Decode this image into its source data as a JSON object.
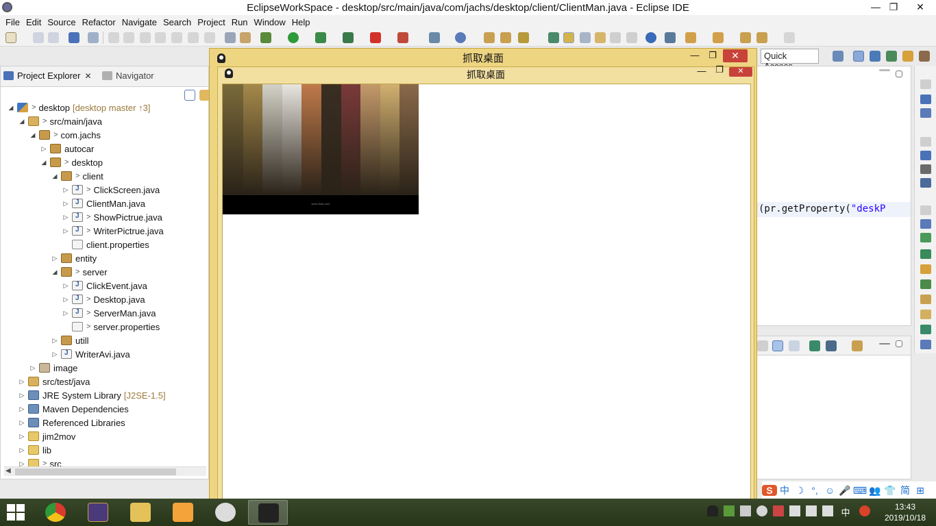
{
  "window": {
    "title": "EclipseWorkSpace - desktop/src/main/java/com/jachs/desktop/client/ClientMan.java - Eclipse IDE",
    "minimize": "—",
    "maximize": "❐",
    "close": "✕"
  },
  "menu": [
    "File",
    "Edit",
    "Source",
    "Refactor",
    "Navigate",
    "Search",
    "Project",
    "Run",
    "Window",
    "Help"
  ],
  "quick_access": "Quick Access",
  "explorer": {
    "tab_active": "Project Explorer",
    "tab_inactive": "Navigator",
    "tree": [
      {
        "label": "desktop",
        "deco": "[desktop master ↑3]",
        "dirty": true,
        "icon": "project",
        "twisty": "▲",
        "indent": 0
      },
      {
        "label": "src/main/java",
        "dirty": true,
        "icon": "srcfolder",
        "twisty": "▲",
        "indent": 1
      },
      {
        "label": "com.jachs",
        "dirty": true,
        "icon": "package",
        "twisty": "▲",
        "indent": 2
      },
      {
        "label": "autocar",
        "icon": "package",
        "twisty": "▷",
        "indent": 3
      },
      {
        "label": "desktop",
        "dirty": true,
        "icon": "package",
        "twisty": "▲",
        "indent": 3
      },
      {
        "label": "client",
        "dirty": true,
        "icon": "package",
        "twisty": "▲",
        "indent": 4
      },
      {
        "label": "ClickScreen.java",
        "dirty": true,
        "icon": "java",
        "twisty": "▷",
        "indent": 5
      },
      {
        "label": "ClientMan.java",
        "icon": "java",
        "twisty": "▷",
        "indent": 5
      },
      {
        "label": "ShowPictrue.java",
        "dirty": true,
        "icon": "java",
        "twisty": "▷",
        "indent": 5
      },
      {
        "label": "WriterPictrue.java",
        "dirty": true,
        "icon": "java",
        "twisty": "▷",
        "indent": 5
      },
      {
        "label": "client.properties",
        "icon": "props",
        "twisty": "",
        "indent": 5
      },
      {
        "label": "entity",
        "icon": "package",
        "twisty": "▷",
        "indent": 4
      },
      {
        "label": "server",
        "dirty": true,
        "icon": "package",
        "twisty": "▲",
        "indent": 4
      },
      {
        "label": "ClickEvent.java",
        "icon": "java",
        "twisty": "▷",
        "indent": 5
      },
      {
        "label": "Desktop.java",
        "dirty": true,
        "icon": "java",
        "twisty": "▷",
        "indent": 5
      },
      {
        "label": "ServerMan.java",
        "dirty": true,
        "icon": "java",
        "twisty": "▷",
        "indent": 5
      },
      {
        "label": "server.properties",
        "dirty": true,
        "icon": "props",
        "twisty": "",
        "indent": 5
      },
      {
        "label": "utill",
        "icon": "package",
        "twisty": "▷",
        "indent": 4
      },
      {
        "label": "WriterAvi.java",
        "icon": "java",
        "twisty": "▷",
        "indent": 4
      },
      {
        "label": "image",
        "icon": "img",
        "twisty": "▷",
        "indent": 2
      },
      {
        "label": "src/test/java",
        "icon": "srcfolder",
        "twisty": "▷",
        "indent": 1
      },
      {
        "label": "JRE System Library",
        "deco": "[J2SE-1.5]",
        "icon": "lib",
        "twisty": "▷",
        "indent": 1
      },
      {
        "label": "Maven Dependencies",
        "icon": "lib",
        "twisty": "▷",
        "indent": 1
      },
      {
        "label": "Referenced Libraries",
        "icon": "lib",
        "twisty": "▷",
        "indent": 1
      },
      {
        "label": "jim2mov",
        "icon": "folder",
        "twisty": "▷",
        "indent": 1
      },
      {
        "label": "lib",
        "icon": "folder",
        "twisty": "▷",
        "indent": 1
      },
      {
        "label": "src",
        "dirty": true,
        "icon": "folder",
        "twisty": "▷",
        "indent": 1
      }
    ]
  },
  "editor": {
    "code_prefix": "(pr.getProperty(",
    "code_string": "\"deskP"
  },
  "capture_dialog": {
    "outer_title": "抓取桌面",
    "inner_title": "抓取桌面",
    "image_caption": "www.2tian.com",
    "strip_colors": [
      "#7a6a3a",
      "#a4894a",
      "#d4d2c8",
      "#e8e6e0",
      "#c07a4a",
      "#3a2e22",
      "#7a3a3a",
      "#c49a6a",
      "#d2b070",
      "#8a6a4a"
    ]
  },
  "ime": [
    "中",
    "☽",
    "°,",
    "☺",
    "🎤",
    "⌨",
    "👥",
    "👕",
    "简",
    "⊞"
  ],
  "clock": {
    "time": "13:43",
    "date": "2019/10/18"
  },
  "colors": {
    "dialog_title": "#eed582",
    "taskbar": "#2f3e22",
    "close_red": "#c7433a"
  }
}
